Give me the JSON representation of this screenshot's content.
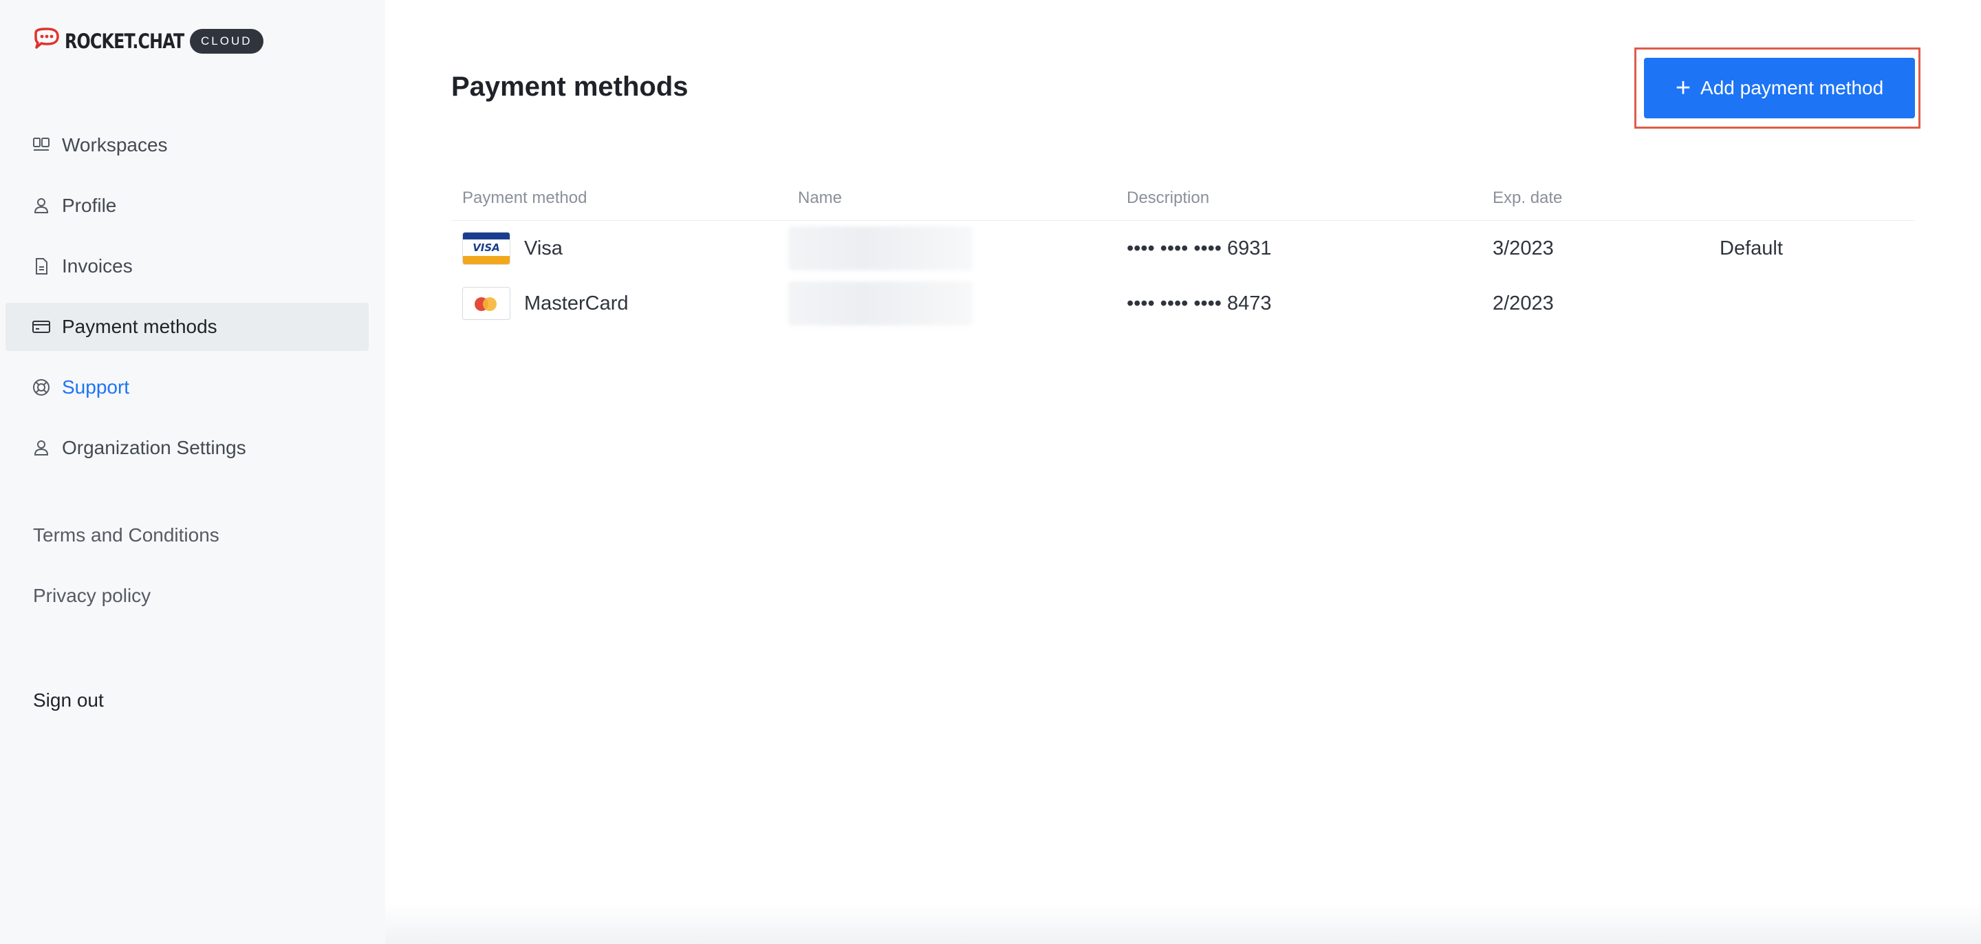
{
  "brand": {
    "name": "ROCKET.CHAT",
    "badge": "CLOUD",
    "accent": "#1d74f5",
    "logo_color": "#e0332c"
  },
  "sidebar": {
    "items": [
      {
        "label": "Workspaces",
        "icon": "workspaces-icon"
      },
      {
        "label": "Profile",
        "icon": "user-icon"
      },
      {
        "label": "Invoices",
        "icon": "document-icon"
      },
      {
        "label": "Payment methods",
        "icon": "credit-card-icon",
        "active": true
      },
      {
        "label": "Support",
        "icon": "support-icon"
      },
      {
        "label": "Organization Settings",
        "icon": "user-icon"
      }
    ],
    "legal": {
      "terms": "Terms and Conditions",
      "privacy": "Privacy policy"
    },
    "sign_out": "Sign out"
  },
  "main": {
    "title": "Payment methods",
    "add_button": {
      "label": "Add payment method",
      "icon": "plus-icon"
    },
    "table": {
      "headers": [
        "Payment method",
        "Name",
        "Description",
        "Exp. date"
      ],
      "rows": [
        {
          "method": "Visa",
          "card_icon": "visa-card-icon",
          "name": "",
          "description": "•••• •••• •••• 6931",
          "exp": "3/2023",
          "default": "Default"
        },
        {
          "method": "MasterCard",
          "card_icon": "mastercard-icon",
          "name": "",
          "description": "•••• •••• •••• 8473",
          "exp": "2/2023",
          "default": ""
        }
      ]
    }
  }
}
